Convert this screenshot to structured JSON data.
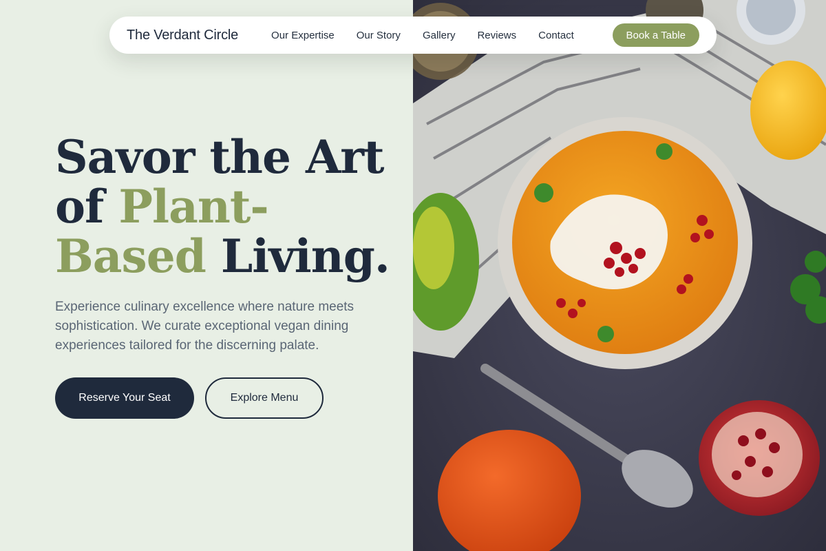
{
  "nav": {
    "brand": "The Verdant Circle",
    "links": [
      "Our Expertise",
      "Our Story",
      "Gallery",
      "Reviews",
      "Contact"
    ],
    "cta": "Book a Table"
  },
  "hero": {
    "headline": {
      "part1": "Savor the Art",
      "part2": "of ",
      "part3": "Plant-",
      "part4": "Based",
      "part5": " Living."
    },
    "lead": "Experience culinary excellence where nature meets sophistication. We curate exceptional vegan dining experiences tailored for the discerning palate.",
    "primary_button": "Reserve Your Seat",
    "secondary_button": "Explore Menu"
  },
  "image": {
    "subject": "pumpkin-soup-bowl-photo"
  },
  "colors": {
    "background": "#e8efe5",
    "navy": "#1f2a3c",
    "olive": "#8c9e5e",
    "text_muted": "#5a6675"
  }
}
